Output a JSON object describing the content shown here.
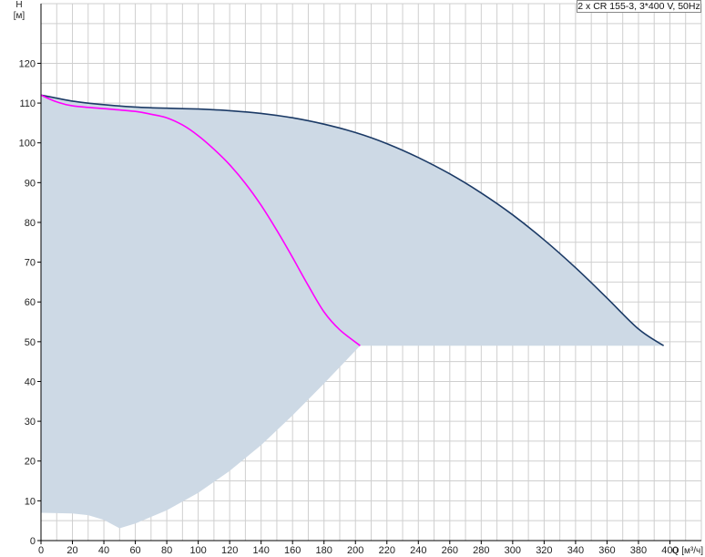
{
  "chart_data": {
    "type": "area",
    "legend_text": "2 x CR 155-3, 3*400 V, 50Hz",
    "ylabel": "H",
    "yunit": "[м]",
    "xlabel": "Q [м³/ч]",
    "xlim": [
      0,
      420
    ],
    "ylim": [
      0,
      135
    ],
    "x_ticks": [
      0,
      20,
      40,
      60,
      80,
      100,
      120,
      140,
      160,
      180,
      200,
      220,
      240,
      260,
      280,
      300,
      320,
      340,
      360,
      380,
      400
    ],
    "y_ticks": [
      0,
      10,
      20,
      30,
      40,
      50,
      60,
      70,
      80,
      90,
      100,
      110,
      120
    ],
    "grid": true,
    "colors": {
      "fill": "#cdd9e5",
      "curve_main": "#1b3a66",
      "curve_secondary": "#ff00ff",
      "grid": "#cfcfcf"
    },
    "series": [
      {
        "values": [
          [
            0,
            112
          ],
          [
            20,
            110.5
          ],
          [
            40,
            109.6
          ],
          [
            60,
            109
          ],
          [
            80,
            108.7
          ],
          [
            100,
            108.5
          ],
          [
            120,
            108.1
          ],
          [
            140,
            107.4
          ],
          [
            160,
            106.3
          ],
          [
            180,
            104.7
          ],
          [
            200,
            102.6
          ],
          [
            220,
            99.8
          ],
          [
            240,
            96.3
          ],
          [
            260,
            92.2
          ],
          [
            280,
            87.4
          ],
          [
            300,
            81.9
          ],
          [
            320,
            75.6
          ],
          [
            340,
            68.6
          ],
          [
            360,
            61
          ],
          [
            380,
            53.2
          ],
          [
            396,
            49
          ]
        ]
      },
      {
        "values": [
          [
            0,
            112
          ],
          [
            10,
            110.3
          ],
          [
            20,
            109.3
          ],
          [
            40,
            108.6
          ],
          [
            60,
            107.9
          ],
          [
            70,
            107.2
          ],
          [
            80,
            106.3
          ],
          [
            90,
            104.5
          ],
          [
            100,
            101.8
          ],
          [
            110,
            98.4
          ],
          [
            120,
            94.5
          ],
          [
            130,
            89.8
          ],
          [
            140,
            84.3
          ],
          [
            150,
            78
          ],
          [
            160,
            71.2
          ],
          [
            170,
            64.1
          ],
          [
            180,
            57.5
          ],
          [
            190,
            53
          ],
          [
            203,
            49
          ]
        ]
      }
    ],
    "envelope_bottom": [
      [
        0,
        7
      ],
      [
        20,
        6.8
      ],
      [
        30,
        6.4
      ],
      [
        40,
        5.2
      ],
      [
        50,
        3.1
      ],
      [
        60,
        4.3
      ],
      [
        80,
        7.6
      ],
      [
        100,
        12
      ],
      [
        120,
        17.5
      ],
      [
        140,
        24
      ],
      [
        160,
        31.5
      ],
      [
        180,
        39.5
      ],
      [
        203,
        49
      ],
      [
        406,
        49
      ]
    ]
  }
}
